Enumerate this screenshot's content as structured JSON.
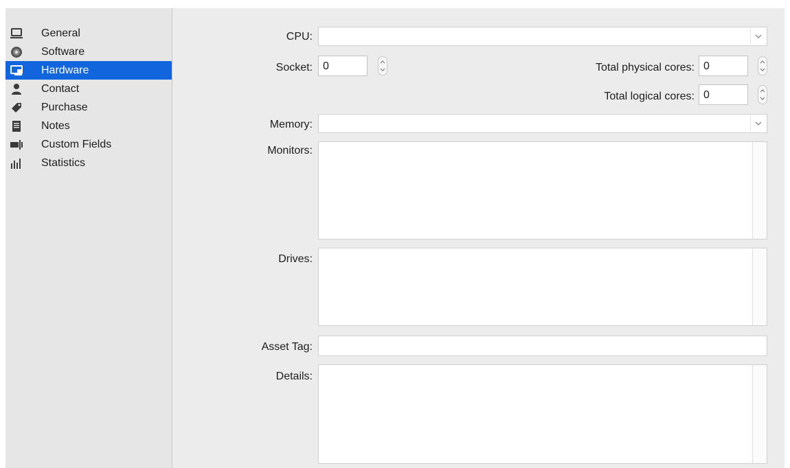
{
  "sidebar": {
    "items": [
      {
        "label": "General",
        "icon": "laptop-icon"
      },
      {
        "label": "Software",
        "icon": "disc-icon"
      },
      {
        "label": "Hardware",
        "icon": "monitor-icon",
        "selected": true
      },
      {
        "label": "Contact",
        "icon": "person-icon"
      },
      {
        "label": "Purchase",
        "icon": "price-tag-icon"
      },
      {
        "label": "Notes",
        "icon": "notes-icon"
      },
      {
        "label": "Custom Fields",
        "icon": "custom-fields-icon"
      },
      {
        "label": "Statistics",
        "icon": "bar-chart-icon"
      }
    ]
  },
  "form": {
    "cpu": {
      "label": "CPU:",
      "value": ""
    },
    "socket": {
      "label": "Socket:",
      "value": "0"
    },
    "physical_cores": {
      "label": "Total physical cores:",
      "value": "0"
    },
    "logical_cores": {
      "label": "Total logical cores:",
      "value": "0"
    },
    "memory": {
      "label": "Memory:",
      "value": ""
    },
    "monitors": {
      "label": "Monitors:",
      "value": ""
    },
    "drives": {
      "label": "Drives:",
      "value": ""
    },
    "asset_tag": {
      "label": "Asset Tag:",
      "value": ""
    },
    "details": {
      "label": "Details:",
      "value": ""
    }
  },
  "colors": {
    "selection": "#1265dc",
    "window_bg": "#ececec",
    "sidebar_bg": "#e6e6e6"
  }
}
